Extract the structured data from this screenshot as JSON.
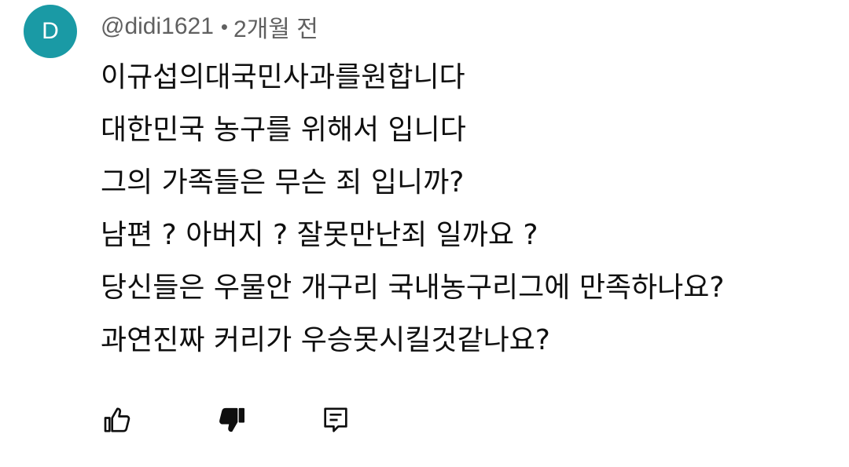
{
  "comment": {
    "avatar_letter": "D",
    "avatar_color": "#1a9aa5",
    "author": "@didi1621",
    "separator": "•",
    "time": "2개월 전",
    "lines": [
      "이규섭의대국민사과를원합니다",
      "대한민국 농구를 위해서 입니다",
      "그의 가족들은 무슨 죄 입니까?",
      "남편 ? 아버지 ? 잘못만난죄 일까요 ?",
      "당신들은 우물안 개구리 국내농구리그에 만족하나요?",
      "과연진짜 커리가 우승못시킬것같나요?"
    ]
  },
  "actions": {
    "like_icon": "thumbs-up-icon",
    "dislike_icon": "thumbs-down-icon",
    "reply_icon": "comment-icon"
  }
}
